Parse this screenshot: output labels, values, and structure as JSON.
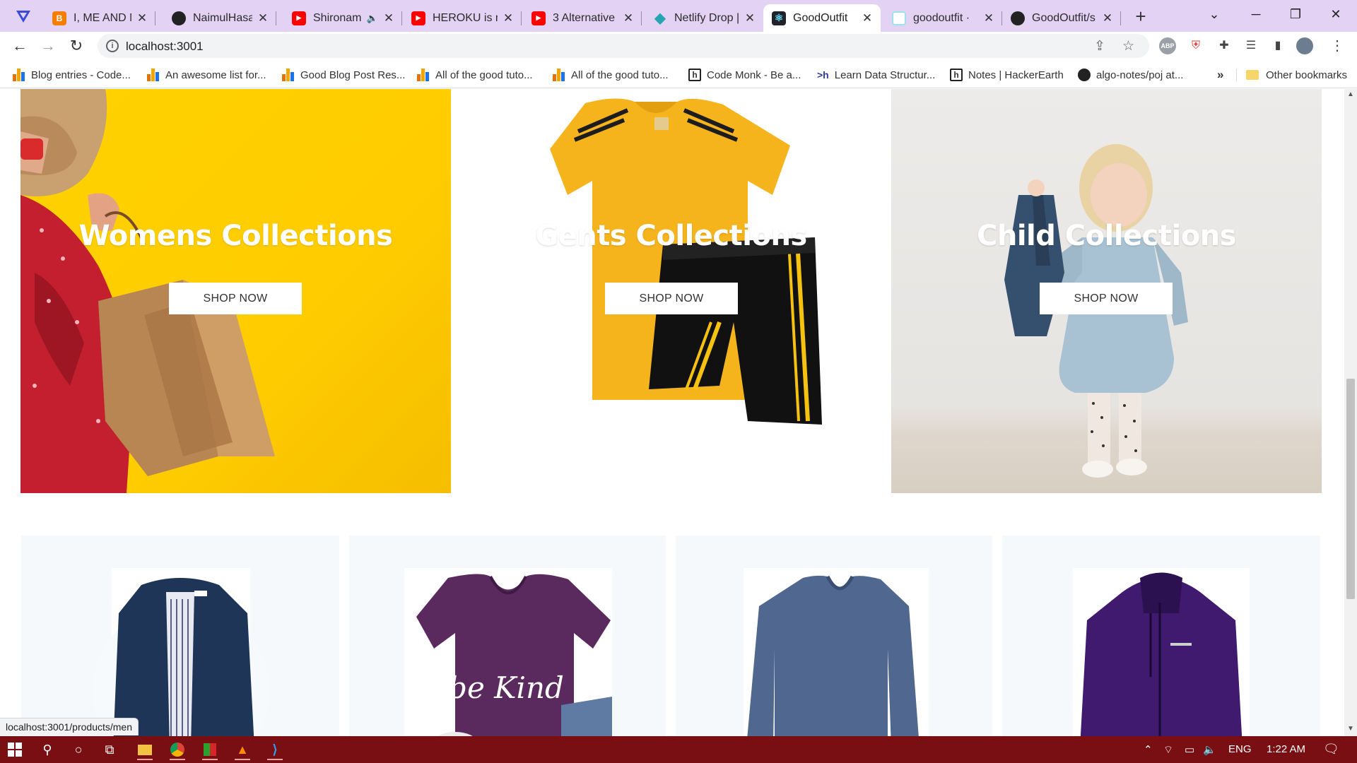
{
  "browser": {
    "tabs": [
      {
        "title": "I, ME AND M",
        "favicon": "blogger-icon",
        "color": "#f57d00",
        "glyph": "B"
      },
      {
        "title": "NaimulHasan",
        "favicon": "github-icon",
        "color": "#222222",
        "glyph": "●"
      },
      {
        "title": "Shironam",
        "favicon": "youtube-icon",
        "color": "#ff0000",
        "glyph": "▶",
        "audio": true
      },
      {
        "title": "HEROKU is no",
        "favicon": "youtube-icon",
        "color": "#ff0000",
        "glyph": "▶"
      },
      {
        "title": "3 Alternative",
        "favicon": "youtube-icon",
        "color": "#ff0000",
        "glyph": "▶"
      },
      {
        "title": "Netlify Drop |",
        "favicon": "netlify-icon",
        "color": "#25a4b3",
        "glyph": "◆"
      },
      {
        "title": "GoodOutfit",
        "favicon": "react-icon",
        "color": "#20232a",
        "glyph": "⚛",
        "active": true
      },
      {
        "title": "goodoutfit ·",
        "favicon": "page-icon",
        "color": "#9be3ea",
        "glyph": ""
      },
      {
        "title": "GoodOutfit/s",
        "favicon": "github-icon",
        "color": "#222222",
        "glyph": "●"
      }
    ],
    "url": "localhost:3001",
    "bookmarks": [
      {
        "label": "Blog entries - Code...",
        "icon": "bars"
      },
      {
        "label": "An awesome list for...",
        "icon": "bars"
      },
      {
        "label": "Good Blog Post Res...",
        "icon": "bars"
      },
      {
        "label": "All of the good tuto...",
        "icon": "bars"
      },
      {
        "label": "All of the good tuto...",
        "icon": "bars"
      },
      {
        "label": "Code Monk - Be a...",
        "icon": "h"
      },
      {
        "label": "Learn Data Structur...",
        "icon": ">h"
      },
      {
        "label": "Notes | HackerEarth",
        "icon": "h"
      },
      {
        "label": "algo-notes/poj at...",
        "icon": "github"
      }
    ],
    "more_bookmarks": "»",
    "other_bookmarks": "Other bookmarks",
    "status_url": "localhost:3001/products/men"
  },
  "page": {
    "collections": [
      {
        "title": "Womens Collections",
        "button": "SHOP NOW"
      },
      {
        "title": "Gents Collections",
        "button": "SHOP NOW"
      },
      {
        "title": "Child Collections",
        "button": "SHOP NOW"
      }
    ],
    "products": [
      {
        "name": "navy-jacket-image"
      },
      {
        "name": "be-kind-tshirt-image",
        "print": "be Kind"
      },
      {
        "name": "blue-sweater-image"
      },
      {
        "name": "purple-jacket-image"
      }
    ]
  },
  "taskbar": {
    "language": "ENG",
    "time": "1:22 AM"
  },
  "colors": {
    "tabstrip": "#e3d2f4",
    "taskbar": "#7a0f13",
    "women_bg": "#ffd200"
  }
}
